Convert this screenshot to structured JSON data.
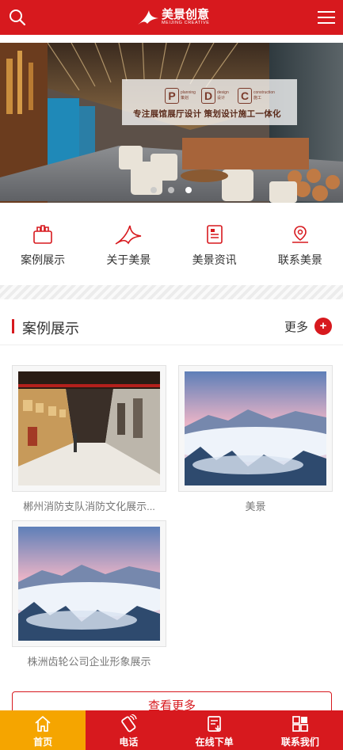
{
  "header": {
    "logo_text": "美景创意",
    "logo_sub": "MEIJING CREATIVE"
  },
  "banner": {
    "pdc": [
      {
        "letter": "P",
        "en": "planning",
        "cn": "策划"
      },
      {
        "letter": "D",
        "en": "design",
        "cn": "设计"
      },
      {
        "letter": "C",
        "en": "construction",
        "cn": "施工"
      }
    ],
    "slogan": "专注展馆展厅设计 策划设计施工一体化",
    "active_slide": 3,
    "slide_count": 3
  },
  "quicknav": [
    {
      "label": "案例展示",
      "icon": "case-icon"
    },
    {
      "label": "关于美景",
      "icon": "brand-icon"
    },
    {
      "label": "美景资讯",
      "icon": "news-icon"
    },
    {
      "label": "联系美景",
      "icon": "location-icon"
    }
  ],
  "section": {
    "title": "案例展示",
    "more_label": "更多",
    "more_icon": "+"
  },
  "cases": [
    {
      "title": "郴州消防支队消防文化展示..."
    },
    {
      "title": "美景"
    },
    {
      "title": "株洲齿轮公司企业形象展示"
    }
  ],
  "view_more_label": "查看更多",
  "bottombar": [
    {
      "label": "首页",
      "icon": "home-icon",
      "active": true
    },
    {
      "label": "电话",
      "icon": "phone-icon",
      "active": false
    },
    {
      "label": "在线下单",
      "icon": "order-icon",
      "active": false
    },
    {
      "label": "联系我们",
      "icon": "grid-icon",
      "active": false
    }
  ],
  "colors": {
    "brand_red": "#d7191e",
    "active_orange": "#f5a500"
  }
}
